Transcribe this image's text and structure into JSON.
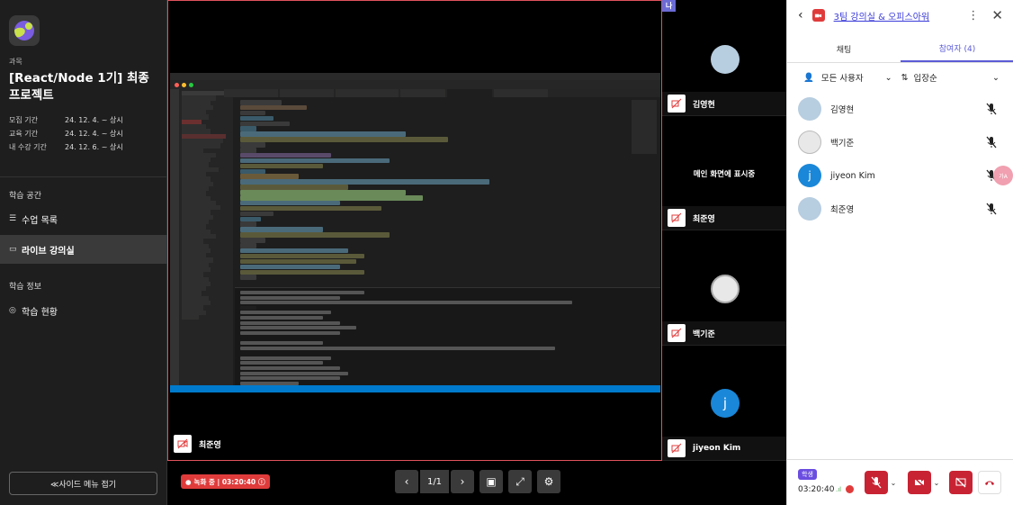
{
  "sidebar": {
    "course_label": "과목",
    "course_title": "[React/Node 1기] 최종 프로젝트",
    "periods": [
      {
        "key": "모집 기간",
        "value": "24. 12. 4. ~ 상시"
      },
      {
        "key": "교육 기간",
        "value": "24. 12. 4. ~ 상시"
      },
      {
        "key": "내 수강 기간",
        "value": "24. 12. 6. ~ 상시"
      }
    ],
    "study_space_title": "학습 공간",
    "lesson_list": "수업 목록",
    "live_room": "라이브 강의실",
    "study_info_title": "학습 정보",
    "study_status": "학습 현황",
    "collapse_button": "≪사이드 메뉴 접기"
  },
  "stage": {
    "main_speaker": "최준영",
    "tiles": [
      {
        "name": "김영현",
        "avatar_color": "#b7cde0",
        "state": "video"
      },
      {
        "name": "최준영",
        "state": "presenting",
        "presenting_text": "메인 화면에 표시중"
      },
      {
        "name": "백기준",
        "avatar_color": "#e8e8e8",
        "state": "video"
      },
      {
        "name": "jiyeon Kim",
        "avatar_letter": "j",
        "avatar_color": "#1a87d8",
        "state": "video"
      }
    ],
    "me_badge": "나"
  },
  "controls": {
    "recording": "녹화 중 | 03:20:40",
    "page_indicator": "1/1"
  },
  "panel": {
    "room_title": "3팀 강의실 & 오피스아워",
    "tab_chat": "채팅",
    "tab_participants": "참여자 (4)",
    "filter_users": "모든 사용자",
    "sort_order": "입장순",
    "participants": [
      {
        "name": "김영현",
        "avatar_color": "#b7cde0",
        "avatar_letter": ""
      },
      {
        "name": "백기준",
        "avatar_color": "#e8e8e8",
        "avatar_letter": ""
      },
      {
        "name": "jiyeon Kim",
        "avatar_color": "#1a87d8",
        "avatar_letter": "j"
      },
      {
        "name": "최준영",
        "avatar_color": "#b7cde0",
        "avatar_letter": ""
      }
    ],
    "role_badge": "학생",
    "elapsed_time": "03:20:40"
  },
  "colors": {
    "accent": "#5b5bd6",
    "record_red": "#e03b3b",
    "control_red": "#c82333",
    "stage_border": "#e0525c"
  }
}
